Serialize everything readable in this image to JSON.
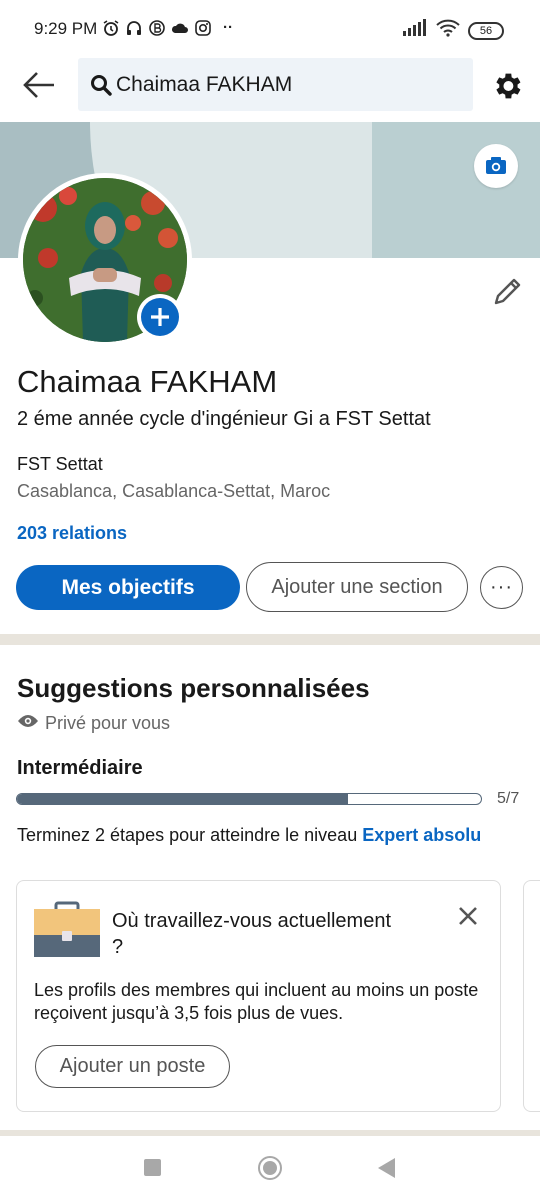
{
  "status_bar": {
    "time": "9:29 PM",
    "more_indicator": "··",
    "battery": "56"
  },
  "top_bar": {
    "search_value": "Chaimaa FAKHAM"
  },
  "profile": {
    "name": "Chaimaa FAKHAM",
    "headline": "2 éme année cycle d'ingénieur Gi a FST Settat",
    "company": "FST Settat",
    "location": "Casablanca, Casablanca-Settat, Maroc",
    "connections": "203 relations"
  },
  "actions": {
    "primary": "Mes objectifs",
    "secondary": "Ajouter une section",
    "more": "···"
  },
  "suggestions": {
    "title": "Suggestions personnalisées",
    "visibility": "Privé pour vous",
    "level": "Intermédiaire",
    "progress_current": 5,
    "progress_total": 7,
    "progress_label": "5/7",
    "hint_text": "Terminez 2 étapes pour atteindre le niveau ",
    "hint_link": "Expert absolu",
    "card": {
      "title": "Où travaillez-vous actuellement ?",
      "description": "Les profils des membres qui incluent au moins un poste reçoivent jusqu’à 3,5 fois plus de vues.",
      "button": "Ajouter un poste"
    }
  },
  "colors": {
    "accent": "#0a66c2",
    "progress": "#56687a"
  },
  "icons": {
    "status_left": [
      "alarm-icon",
      "headphones-icon",
      "b-badge-icon",
      "cloud-icon",
      "instagram-icon"
    ],
    "status_right": [
      "signal-icon",
      "wifi-icon",
      "battery-icon"
    ],
    "top_bar": [
      "back-arrow-icon",
      "search-icon",
      "gear-icon"
    ],
    "profile": [
      "camera-icon",
      "plus-icon",
      "pencil-icon"
    ],
    "suggestions": [
      "eye-icon",
      "briefcase-icon",
      "close-icon"
    ],
    "navbar": [
      "recents-icon",
      "home-icon",
      "back-icon"
    ]
  }
}
